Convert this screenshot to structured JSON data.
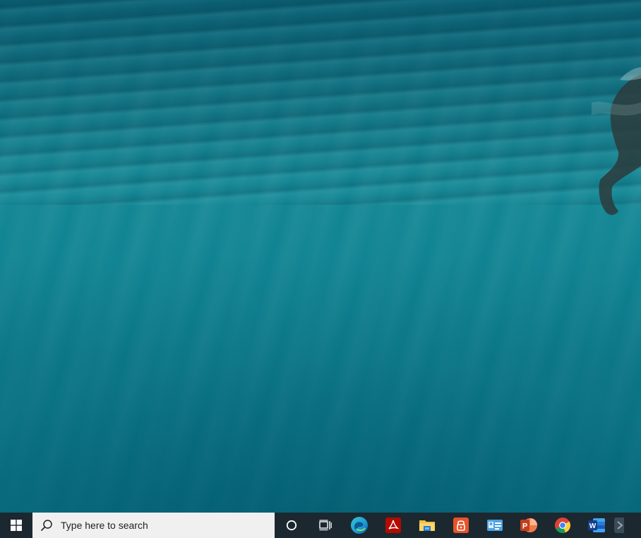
{
  "desktop": {
    "wallpaper": "underwater-ocean-wallpaper"
  },
  "taskbar": {
    "background": "#1c2830",
    "start_icon": "windows-logo-icon",
    "search": {
      "icon": "search-icon",
      "placeholder": "Type here to search"
    },
    "buttons": [
      {
        "name": "cortana-button",
        "icon": "circle-icon"
      },
      {
        "name": "task-view-button",
        "icon": "task-view-icon"
      }
    ],
    "pinned_apps": [
      {
        "name": "edge",
        "icon": "edge-icon",
        "color": "#1a9bd7"
      },
      {
        "name": "acrobat",
        "icon": "acrobat-icon",
        "color": "#b30b00"
      },
      {
        "name": "file-explorer",
        "icon": "folder-icon",
        "color": "#f4c043"
      },
      {
        "name": "password-manager",
        "icon": "lock-app-icon",
        "color": "#e8542a"
      },
      {
        "name": "contact-card",
        "icon": "id-card-icon",
        "color": "#4fa3e0"
      },
      {
        "name": "powerpoint",
        "icon": "powerpoint-icon",
        "color": "#d04423"
      },
      {
        "name": "chrome",
        "icon": "chrome-icon",
        "color": "#4285f4"
      },
      {
        "name": "word",
        "icon": "word-icon",
        "color": "#2b5797"
      },
      {
        "name": "partial-app",
        "icon": "app-icon",
        "color": "#9aa7b3"
      }
    ]
  }
}
